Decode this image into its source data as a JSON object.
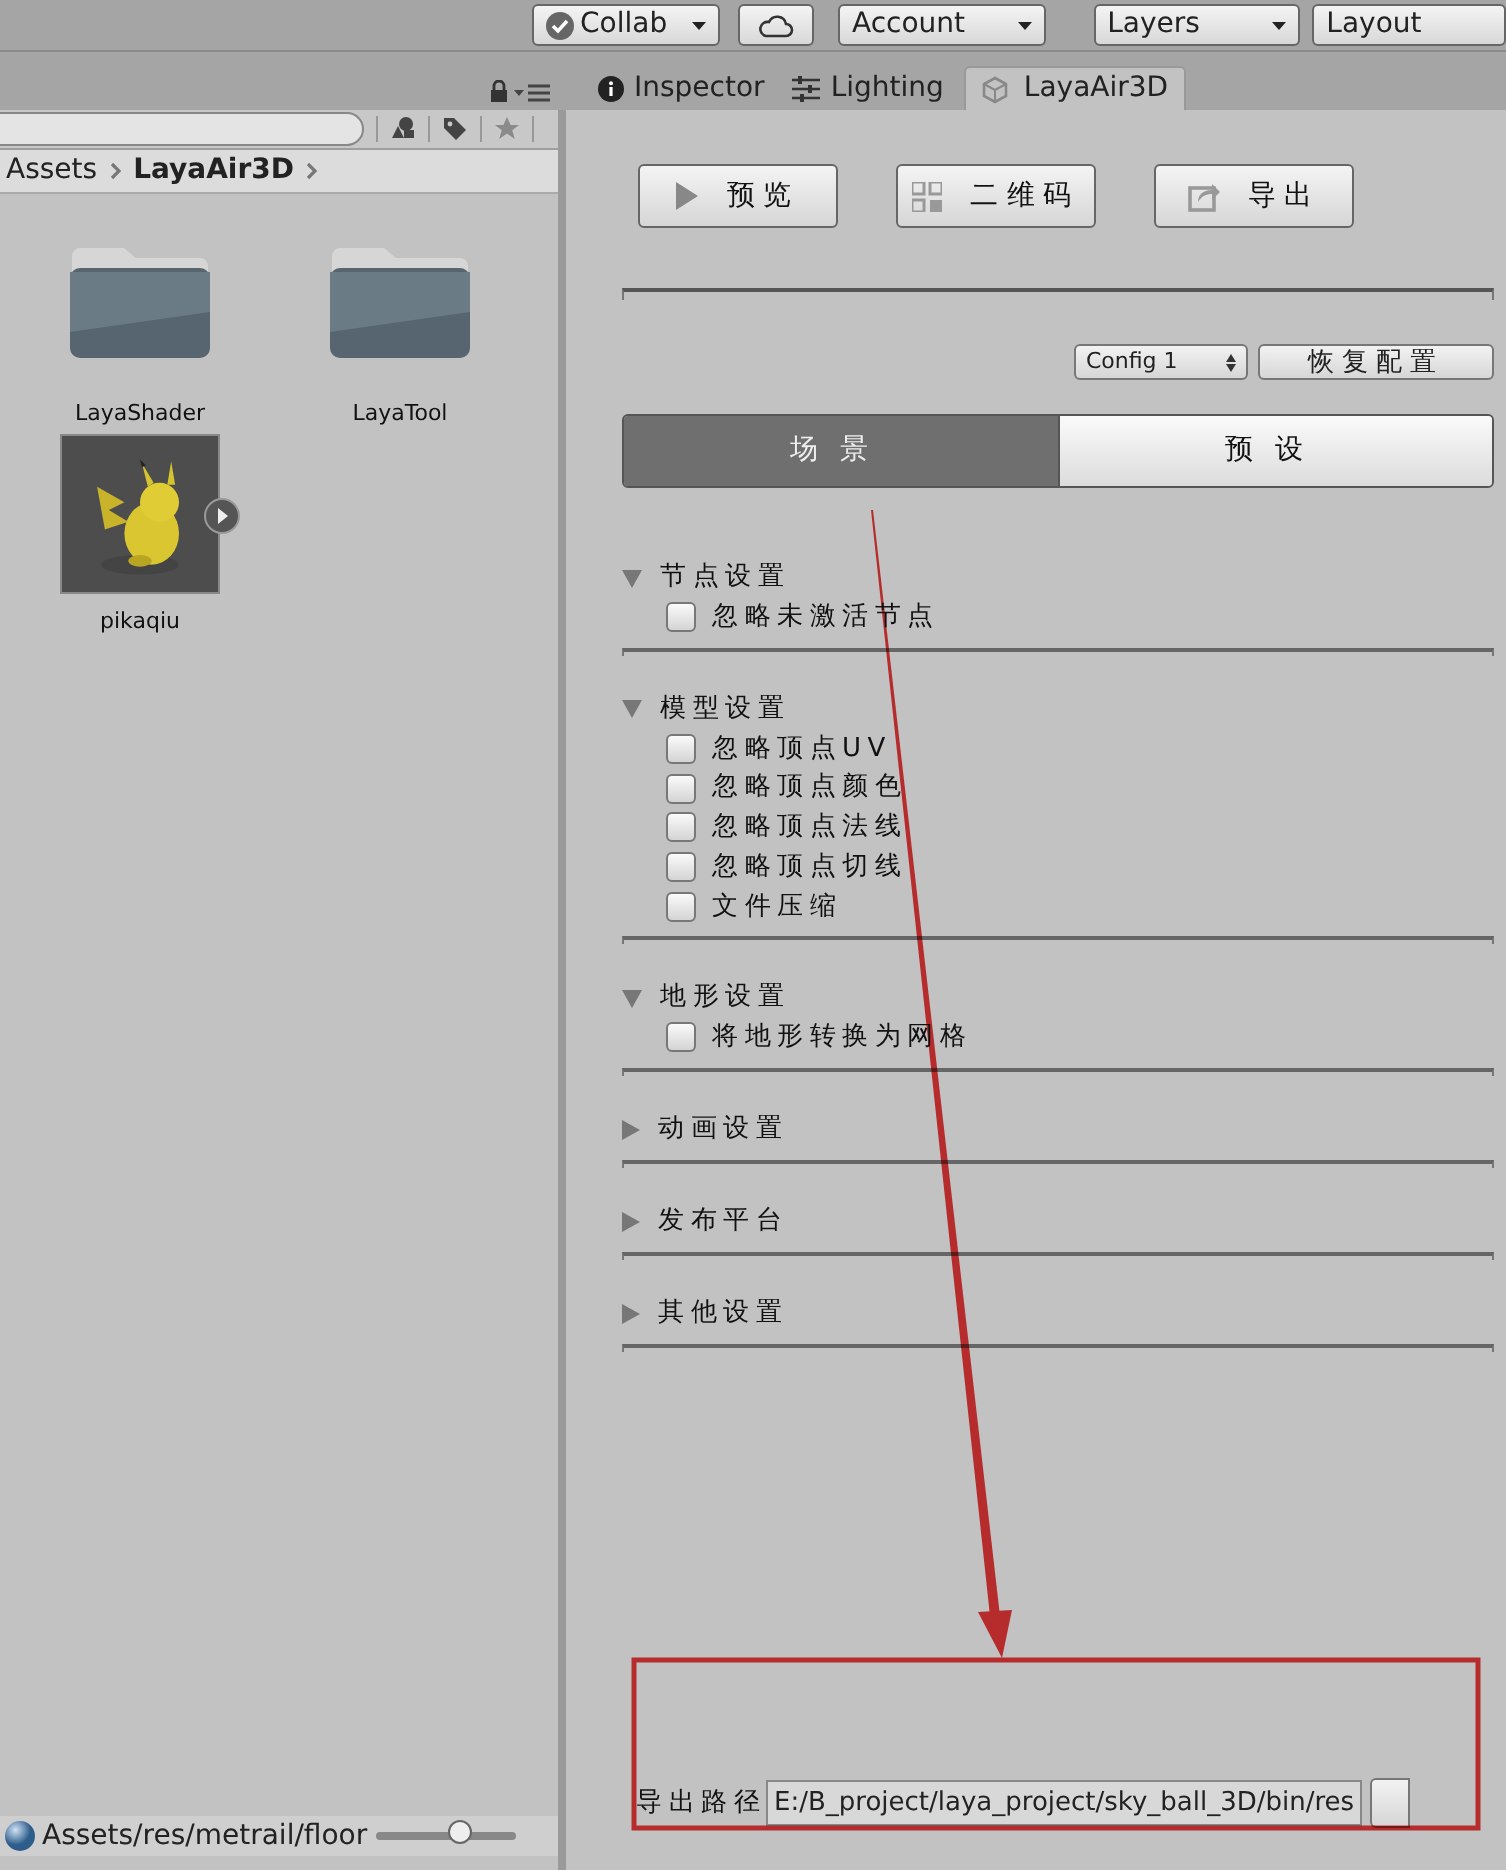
{
  "toolbar": {
    "buttons": [
      {
        "kind": "check_dropdown",
        "label": "Collab"
      },
      {
        "kind": "cloud"
      },
      {
        "kind": "dropdown",
        "label": "Account"
      },
      {
        "kind": "dropdown",
        "label": "Layers"
      },
      {
        "kind": "dropdown",
        "label": "Layout"
      }
    ]
  },
  "project": {
    "breadcrumb": [
      "Assets",
      "LayaAir3D"
    ],
    "items": [
      {
        "kind": "folder",
        "name": "LayaShader"
      },
      {
        "kind": "folder",
        "name": "LayaTool"
      },
      {
        "kind": "model",
        "name": "pikaqiu"
      }
    ],
    "status_path": "Assets/res/metrail/floor",
    "status_slider": {
      "level": 0.6
    }
  },
  "tabs": [
    {
      "kind": "info",
      "label": "Inspector",
      "selected": false
    },
    {
      "kind": "sliders",
      "label": "Lighting",
      "selected": false
    },
    {
      "kind": "cube",
      "label": "LayaAir3D",
      "selected": true
    }
  ],
  "actions": [
    {
      "kind": "play",
      "label": "预览"
    },
    {
      "kind": "qr",
      "label": "二维码"
    },
    {
      "kind": "export",
      "label": "导出"
    }
  ],
  "config": {
    "value": "Config 1",
    "reset": "恢复配置"
  },
  "modes": [
    {
      "label": "场景",
      "selected": true
    },
    {
      "label": "预设",
      "selected": false
    }
  ],
  "sections": [
    {
      "title": "节点设置",
      "expanded": true,
      "options": [
        {
          "label": "忽略未激活节点",
          "checked": false
        }
      ]
    },
    {
      "title": "模型设置",
      "expanded": true,
      "options": [
        {
          "label": "忽略顶点UV",
          "checked": false
        },
        {
          "label": "忽略顶点颜色",
          "checked": false
        },
        {
          "label": "忽略顶点法线",
          "checked": false
        },
        {
          "label": "忽略顶点切线",
          "checked": false
        },
        {
          "label": "文件压缩",
          "checked": false
        }
      ]
    },
    {
      "title": "地形设置",
      "expanded": true,
      "options": [
        {
          "label": "将地形转换为网格",
          "checked": false
        }
      ]
    },
    {
      "title": "动画设置",
      "expanded": false
    },
    {
      "title": "发布平台",
      "expanded": false
    },
    {
      "title": "其他设置",
      "expanded": false
    }
  ],
  "export_path": {
    "label": "导出路径",
    "value": "E:/B_project/laya_project/sky_ball_3D/bin/res"
  }
}
